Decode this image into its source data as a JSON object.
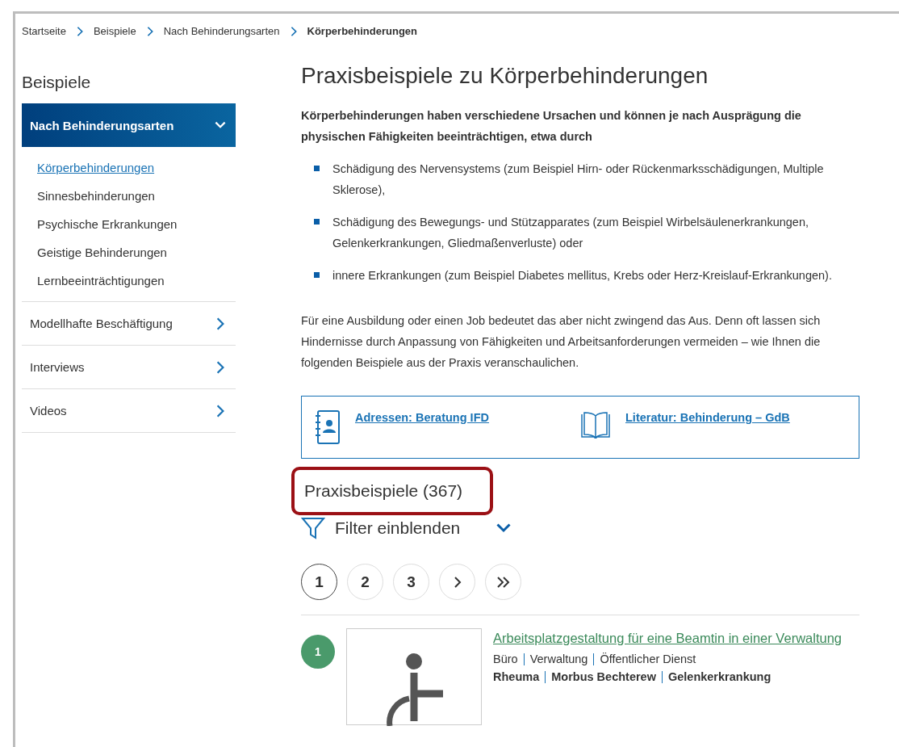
{
  "breadcrumb": [
    {
      "label": "Startseite",
      "current": false
    },
    {
      "label": "Beispiele",
      "current": false
    },
    {
      "label": "Nach Behinderungsarten",
      "current": false
    },
    {
      "label": "Körperbehinderungen",
      "current": true
    }
  ],
  "sidebar": {
    "title": "Beispiele",
    "sections": [
      {
        "label": "Nach Behinderungsarten",
        "expanded": true,
        "children": [
          {
            "label": "Körperbehinderungen",
            "selected": true
          },
          {
            "label": "Sinnesbehinderungen",
            "selected": false
          },
          {
            "label": "Psychische Erkrankungen",
            "selected": false
          },
          {
            "label": "Geistige Behinderungen",
            "selected": false
          },
          {
            "label": "Lernbeeinträchtigungen",
            "selected": false
          }
        ]
      },
      {
        "label": "Modellhafte Beschäftigung",
        "expanded": false
      },
      {
        "label": "Interviews",
        "expanded": false
      },
      {
        "label": "Videos",
        "expanded": false
      }
    ]
  },
  "main": {
    "title": "Praxisbeispiele zu Körperbehinderungen",
    "intro": "Körperbehinderungen haben verschiedene Ursachen und können je nach Ausprägung die physischen Fähigkeiten beeinträchtigen, etwa durch",
    "bullets": [
      "Schädigung des Nervensystems (zum Beispiel Hirn- oder Rückenmarksschädigungen, Multiple Sklerose),",
      "Schädigung des Bewegungs- und Stützapparates (zum Beispiel Wirbelsäulenerkrankungen, Gelenkerkrankungen, Gliedmaßenverluste) oder",
      "innere Erkrankungen (zum Beispiel Diabetes mellitus, Krebs oder Herz-Kreislauf-Erkrankungen)."
    ],
    "paragraph": "Für eine Ausbildung oder einen Job bedeutet das aber nicht zwingend das Aus. Denn oft lassen sich Hindernisse durch Anpassung von Fähigkeiten und Arbeitsanforderungen vermeiden – wie Ihnen die folgenden Beispiele aus der Praxis veranschaulichen.",
    "links": [
      {
        "kind": "address",
        "label": "Adressen: Beratung IFD"
      },
      {
        "kind": "book",
        "label": "Literatur: Behinderung – GdB"
      }
    ],
    "results_heading": {
      "text": "Praxisbeispiele (367)",
      "highlighted": true
    },
    "filter": {
      "label": "Filter einblenden",
      "expanded": false
    },
    "pagination": [
      {
        "kind": "page",
        "label": "1",
        "selected": true
      },
      {
        "kind": "page",
        "label": "2",
        "selected": false
      },
      {
        "kind": "page",
        "label": "3",
        "selected": false
      },
      {
        "kind": "next",
        "selected": false
      },
      {
        "kind": "last",
        "selected": false
      }
    ],
    "results": [
      {
        "number": "1",
        "title": "Arbeitsplatzgestaltung für eine Beamtin in einer Verwaltung",
        "sectors": [
          "Büro",
          "Verwaltung",
          "Öffentlicher Dienst"
        ],
        "conditions": [
          "Rheuma",
          "Morbus Bechterew",
          "Gelenkerkrankung"
        ]
      }
    ]
  }
}
